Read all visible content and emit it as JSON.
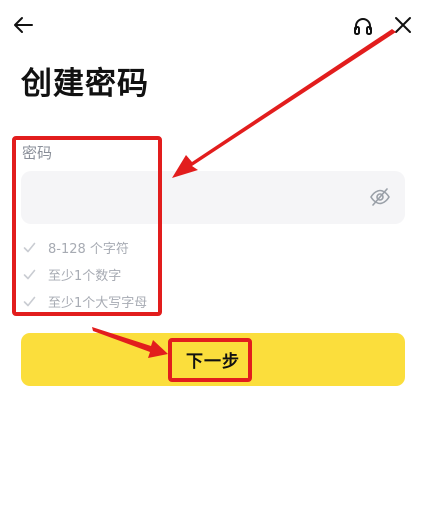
{
  "header": {
    "back_icon": "arrow-left-icon",
    "support_icon": "headset-icon",
    "close_icon": "close-icon"
  },
  "main": {
    "title": "创建密码",
    "password_field": {
      "label": "密码",
      "value": "",
      "placeholder": "",
      "visibility_icon": "eye-off-icon"
    },
    "requirements": [
      {
        "label": "8-128 个字符",
        "met": false
      },
      {
        "label": "至少1个数字",
        "met": false
      },
      {
        "label": "至少1个大写字母",
        "met": false
      }
    ],
    "next_button_label": "下一步"
  },
  "colors": {
    "accent_button": "#fbde3c",
    "annotation_red": "#e21d1d",
    "input_bg": "#f5f5f7",
    "muted_text": "#a7abb3",
    "label_text": "#8a8f99"
  }
}
